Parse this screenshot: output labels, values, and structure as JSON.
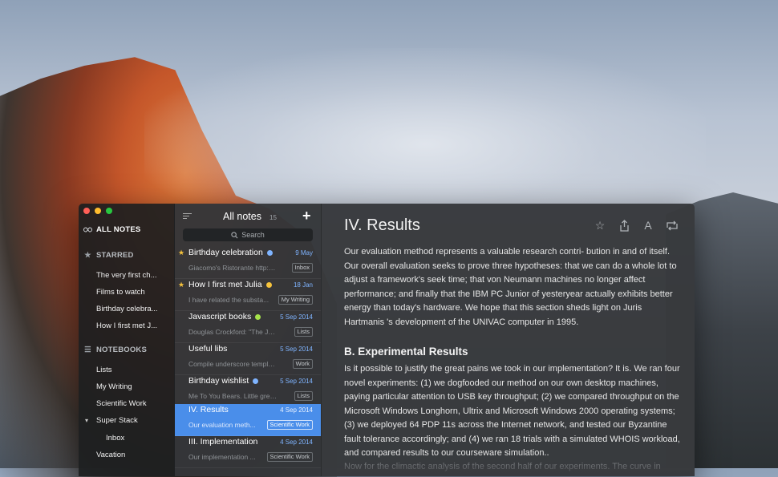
{
  "sidebar": {
    "all_notes": "ALL NOTES",
    "starred_label": "STARRED",
    "starred": [
      "The very first ch...",
      "Films to watch",
      "Birthday celebra...",
      "How I first met J..."
    ],
    "notebooks_label": "NOTEBOOKS",
    "notebooks": [
      "Lists",
      "My Writing",
      "Scientific Work",
      "Super Stack",
      "Inbox",
      "Vacation"
    ]
  },
  "list": {
    "title": "All notes",
    "count": "15",
    "search_placeholder": "Search",
    "notes": [
      {
        "title": "Birthday celebration",
        "date": "9 May",
        "snippet": "Giacomo's Ristorante http://...",
        "notebook": "Inbox",
        "starred": true,
        "dot": "#7fb4ff"
      },
      {
        "title": "How I first met Julia",
        "date": "18 Jan",
        "snippet": "I have related the substa...",
        "notebook": "My Writing",
        "starred": true,
        "dot": "#f6c33c"
      },
      {
        "title": "Javascript books",
        "date": "5 Sep 2014",
        "snippet": "Douglas Crockford: \"The Java...",
        "notebook": "Lists",
        "starred": false,
        "dot": "#a6e34a"
      },
      {
        "title": "Useful libs",
        "date": "5 Sep 2014",
        "snippet": "Compile underscore template...",
        "notebook": "Work",
        "starred": false,
        "dot": ""
      },
      {
        "title": "Birthday wishlist",
        "date": "5 Sep 2014",
        "snippet": "Me To You Bears. Little grey b...",
        "notebook": "Lists",
        "starred": false,
        "dot": "#7fb4ff"
      },
      {
        "title": "IV. Results",
        "date": "4 Sep 2014",
        "snippet": "Our evaluation meth...",
        "notebook": "Scientific Work",
        "starred": false,
        "dot": ""
      },
      {
        "title": "III. Implementation",
        "date": "4 Sep 2014",
        "snippet": "Our implementation ...",
        "notebook": "Scientific Work",
        "starred": false,
        "dot": ""
      }
    ]
  },
  "editor": {
    "title": "IV. Results",
    "para1": "Our evaluation method represents a valuable research contri- bution in and of itself. Our overall evaluation seeks to prove three hypotheses: that we can do a whole lot to adjust a framework's seek time; that von Neumann machines no longer affect performance; and finally that the IBM PC Junior of yesteryear actually exhibits better energy than today's hardware. We hope that this section sheds light on Juris Hartmanis 's development of the UNIVAC computer in 1995.",
    "subhead": "B. Experimental Results",
    "para2": "Is it possible to justify the great pains we took in our implementation? It is. We ran four novel experiments: (1) we dogfooded our method on our own desktop machines, paying particular attention to USB key throughput; (2) we compared throughput on the Microsoft Windows Longhorn, Ultrix and Microsoft Windows 2000 operating systems; (3) we deployed 64 PDP 11s across the Internet network, and tested our Byzantine fault tolerance accordingly; and (4) we ran 18 trials with a simulated WHOIS workload, and compared results to our courseware simulation..",
    "para3": "Now for the climactic analysis of the second half of our experiments. The curve in"
  },
  "colors": {
    "accent": "#4a8eea",
    "star": "#f6c33c",
    "date": "#7fb4ff"
  }
}
